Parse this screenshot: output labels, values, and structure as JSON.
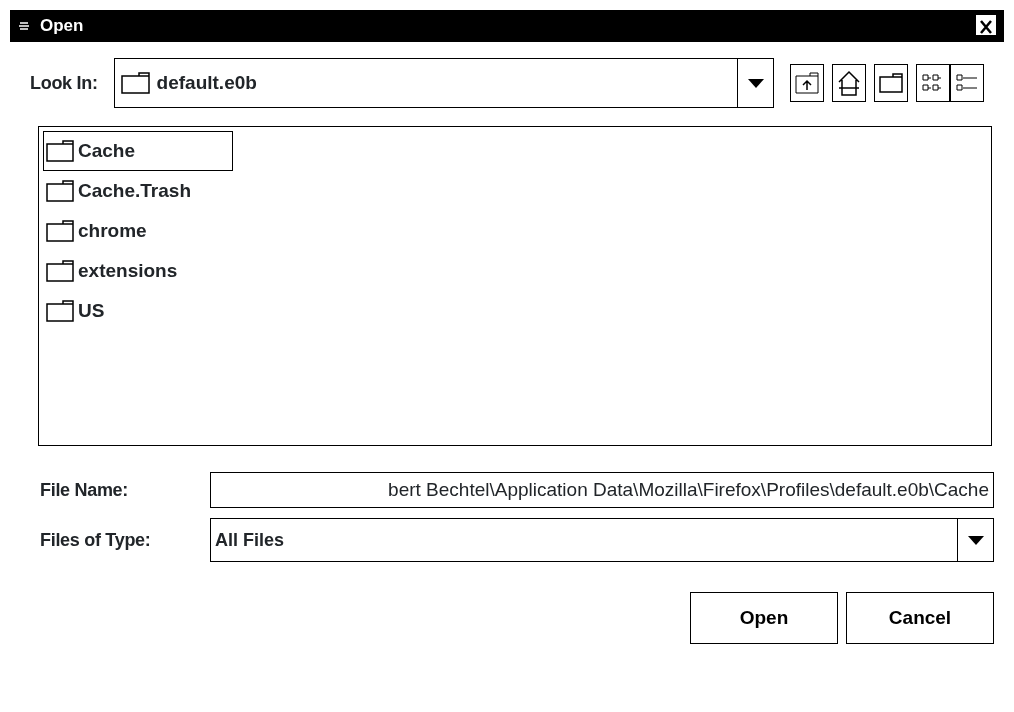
{
  "window": {
    "title": "Open"
  },
  "look_in": {
    "label": "Look In:",
    "value": "default.e0b"
  },
  "files": [
    {
      "name": "Cache",
      "selected": true
    },
    {
      "name": "Cache.Trash",
      "selected": false
    },
    {
      "name": "chrome",
      "selected": false
    },
    {
      "name": "extensions",
      "selected": false
    },
    {
      "name": "US",
      "selected": false
    }
  ],
  "file_name": {
    "label": "File Name:",
    "value": "bert Bechtel\\Application Data\\Mozilla\\Firefox\\Profiles\\default.e0b\\Cache"
  },
  "file_type": {
    "label": "Files of Type:",
    "value": "All Files"
  },
  "buttons": [
    "Open",
    "Cancel"
  ]
}
